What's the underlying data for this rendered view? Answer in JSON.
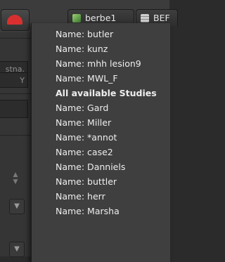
{
  "tabs": [
    {
      "label": "berbe1",
      "icon": "study-icon"
    },
    {
      "label": "BEF",
      "icon": "database-icon"
    }
  ],
  "left_panel": {
    "field1_text": "stna.",
    "field2_text": "Y"
  },
  "menu": {
    "items": [
      {
        "text": "Name: butler",
        "type": "item"
      },
      {
        "text": "Name: kunz",
        "type": "item"
      },
      {
        "text": "Name: mhh lesion9",
        "type": "item"
      },
      {
        "text": "Name: MWL_F",
        "type": "item"
      },
      {
        "text": "All available Studies",
        "type": "header"
      },
      {
        "text": "Name: Gard",
        "type": "item"
      },
      {
        "text": "Name: Miller",
        "type": "item"
      },
      {
        "text": "Name: *annot",
        "type": "item"
      },
      {
        "text": "Name: case2",
        "type": "item"
      },
      {
        "text": "Name: Danniels",
        "type": "item"
      },
      {
        "text": "Name: buttler",
        "type": "item"
      },
      {
        "text": "Name: herr",
        "type": "item"
      },
      {
        "text": "Name: Marsha",
        "type": "item"
      }
    ]
  }
}
